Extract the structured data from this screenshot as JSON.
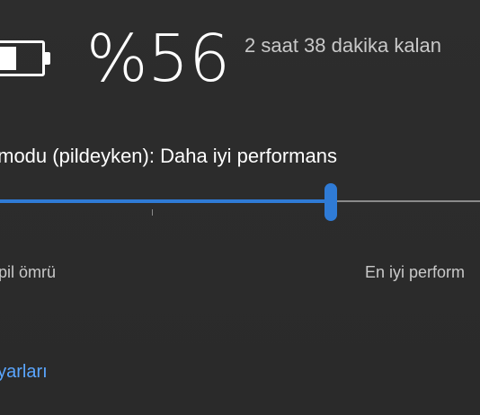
{
  "battery": {
    "icon": "battery-icon",
    "level_fraction": 0.56,
    "percent_text": "%56",
    "remaining_text": "2 saat 38 dakika kalan"
  },
  "power_mode": {
    "label": "ç modu (pildeyken): Daha iyi performans",
    "slider": {
      "value_fraction": 0.69,
      "accent_color": "#2f7bd6",
      "track_color": "#8a8a8a"
    },
    "left_label": "yi pil ömrü",
    "right_label": "En iyi perform"
  },
  "footer": {
    "link_text": "ayarları",
    "link_color": "#5aa6ff"
  }
}
